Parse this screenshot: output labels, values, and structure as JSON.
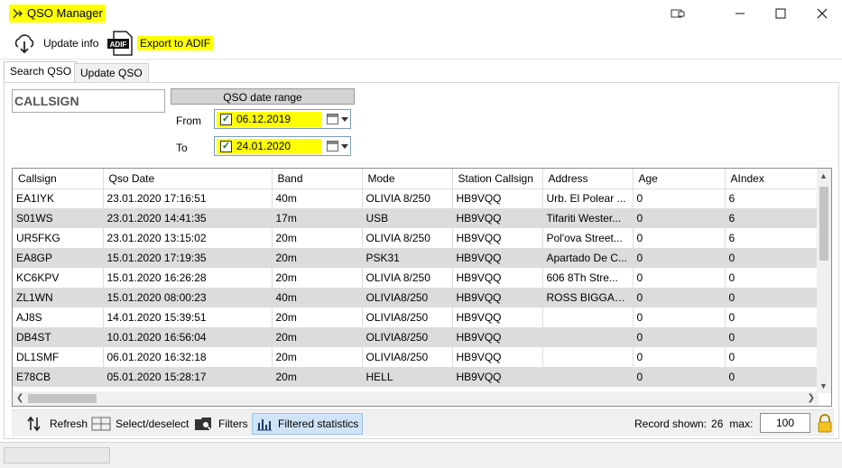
{
  "window": {
    "title": "QSO Manager",
    "controls": [
      "restore-icon",
      "minimize-icon",
      "maximize-icon",
      "close-icon"
    ]
  },
  "toolbar": {
    "update_info": "Update info",
    "export_adif": "Export to ADIF",
    "adif_badge": "ADIF"
  },
  "tabs": [
    "Search QSO",
    "Update QSO"
  ],
  "search": {
    "callsign_placeholder": "CALLSIGN",
    "date_range_label": "QSO date range",
    "from_label": "From",
    "from_value": "06.12.2019",
    "from_checked": true,
    "to_label": "To",
    "to_value": "24.01.2020",
    "to_checked": true
  },
  "grid": {
    "columns": [
      "Callsign",
      "Qso Date",
      "Band",
      "Mode",
      "Station Callsign",
      "Address",
      "Age",
      "AIndex"
    ],
    "rows": [
      [
        "EA1IYK",
        "23.01.2020 17:16:51",
        "40m",
        "OLIVIA 8/250",
        "HB9VQQ",
        "Urb. El Polear ...",
        "0",
        "6"
      ],
      [
        "S01WS",
        "23.01.2020 14:41:35",
        "17m",
        "USB",
        "HB9VQQ",
        "Tifariti Wester...",
        "0",
        "6"
      ],
      [
        "UR5FKG",
        "23.01.2020 13:15:02",
        "20m",
        "OLIVIA 8/250",
        "HB9VQQ",
        "Pol'ova Street...",
        "0",
        "6"
      ],
      [
        "EA8GP",
        "15.01.2020 17:19:35",
        "20m",
        "PSK31",
        "HB9VQQ",
        "Apartado De C...",
        "0",
        "0"
      ],
      [
        "KC6KPV",
        "15.01.2020 16:26:28",
        "20m",
        "OLIVIA 8/250",
        "HB9VQQ",
        "606 8Th Stre...",
        "0",
        "0"
      ],
      [
        "ZL1WN",
        "15.01.2020 08:00:23",
        "40m",
        "OLIVIA8/250",
        "HB9VQQ",
        "ROSS BIGGAR,...",
        "0",
        "0"
      ],
      [
        "AJ8S",
        "14.01.2020 15:39:51",
        "20m",
        "OLIVIA8/250",
        "HB9VQQ",
        "",
        "0",
        "0"
      ],
      [
        "DB4ST",
        "10.01.2020 16:56:04",
        "20m",
        "OLIVIA8/250",
        "HB9VQQ",
        "",
        "0",
        "0"
      ],
      [
        "DL1SMF",
        "06.01.2020 16:32:18",
        "20m",
        "OLIVIA8/250",
        "HB9VQQ",
        "",
        "0",
        "0"
      ],
      [
        "E78CB",
        "05.01.2020 15:28:17",
        "20m",
        "HELL",
        "HB9VQQ",
        "",
        "0",
        "0"
      ]
    ]
  },
  "bottom": {
    "refresh": "Refresh",
    "select_deselect": "Select/deselect",
    "filters": "Filters",
    "filtered_statistics": "Filtered statistics",
    "record_shown_label": "Record shown:",
    "record_shown_value": "26",
    "max_label": "max:",
    "max_value": "100"
  },
  "colors": {
    "highlight": "#ffff00",
    "row_alt": "#dcdcdc",
    "active_button": "#cfe4f7"
  }
}
